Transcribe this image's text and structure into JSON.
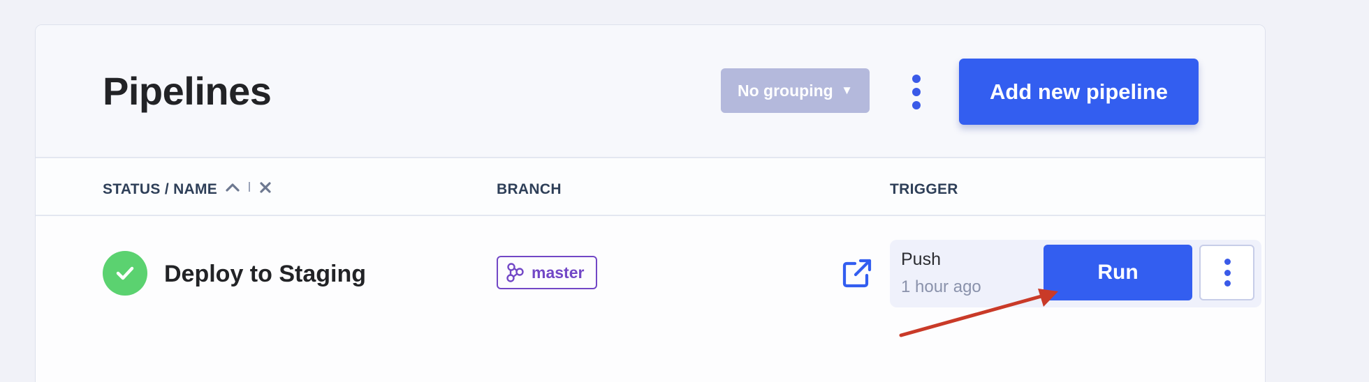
{
  "header": {
    "title": "Pipelines",
    "grouping_label": "No grouping",
    "add_button_label": "Add new pipeline"
  },
  "columns": {
    "status_name": "STATUS / NAME",
    "branch": "BRANCH",
    "trigger": "TRIGGER"
  },
  "pipelines": [
    {
      "name": "Deploy to Staging",
      "status": "success",
      "branch": "master",
      "trigger_type": "Push",
      "trigger_time": "1 hour ago",
      "run_label": "Run"
    }
  ],
  "icons": {
    "grouping_caret": "caret-down-icon",
    "header_more": "kebab-menu-icon",
    "sort": "chevron-up-icon",
    "clear_sort": "close-icon",
    "status": "check-icon",
    "branch": "git-branch-icon",
    "open": "external-link-icon",
    "row_more": "kebab-menu-icon",
    "annotation": "arrow-annotation"
  },
  "colors": {
    "accent": "#335ef0",
    "success": "#5bd270",
    "branch": "#7247c6",
    "grouping_bg": "#b4b9dc",
    "annotation": "#c93a28"
  }
}
